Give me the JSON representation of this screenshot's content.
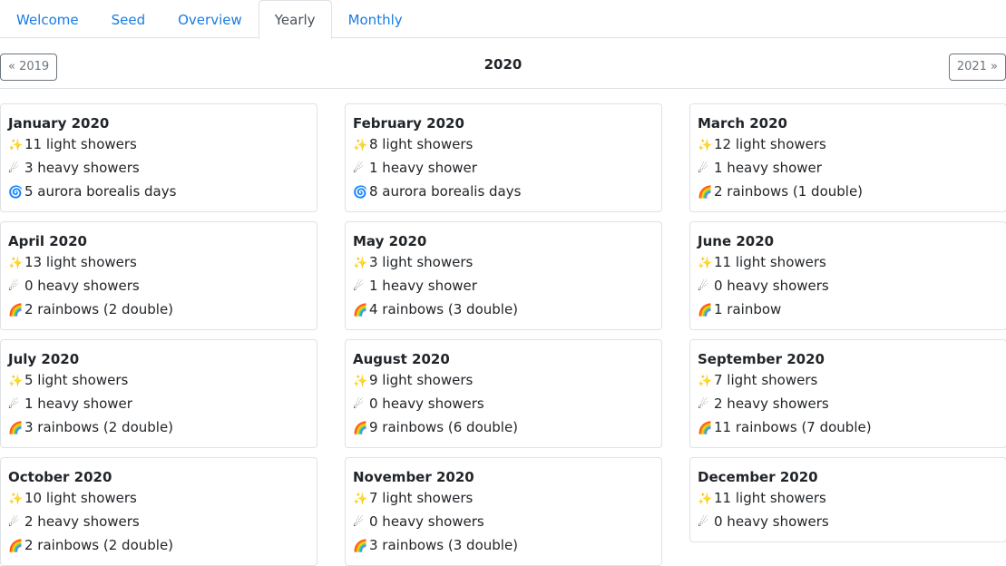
{
  "tabs": [
    {
      "label": "Welcome",
      "active": false
    },
    {
      "label": "Seed",
      "active": false
    },
    {
      "label": "Overview",
      "active": false
    },
    {
      "label": "Yearly",
      "active": true
    },
    {
      "label": "Monthly",
      "active": false
    }
  ],
  "year": {
    "title": "2020",
    "prev_label": "« 2019",
    "next_label": "2021 »"
  },
  "icons": {
    "light": "✨",
    "heavy": "☄",
    "aurora": "🌀",
    "rainbow": "🌈"
  },
  "months": [
    {
      "title": "January 2020",
      "lines": [
        {
          "icon": "light",
          "text": "11 light showers"
        },
        {
          "icon": "heavy",
          "text": "3 heavy showers"
        },
        {
          "icon": "aurora",
          "text": "5 aurora borealis days"
        }
      ]
    },
    {
      "title": "February 2020",
      "lines": [
        {
          "icon": "light",
          "text": "8 light showers"
        },
        {
          "icon": "heavy",
          "text": "1 heavy shower"
        },
        {
          "icon": "aurora",
          "text": "8 aurora borealis days"
        }
      ]
    },
    {
      "title": "March 2020",
      "lines": [
        {
          "icon": "light",
          "text": "12 light showers"
        },
        {
          "icon": "heavy",
          "text": "1 heavy shower"
        },
        {
          "icon": "rainbow",
          "text": "2 rainbows (1 double)"
        }
      ]
    },
    {
      "title": "April 2020",
      "lines": [
        {
          "icon": "light",
          "text": "13 light showers"
        },
        {
          "icon": "heavy",
          "text": "0 heavy showers"
        },
        {
          "icon": "rainbow",
          "text": "2 rainbows (2 double)"
        }
      ]
    },
    {
      "title": "May 2020",
      "lines": [
        {
          "icon": "light",
          "text": "3 light showers"
        },
        {
          "icon": "heavy",
          "text": "1 heavy shower"
        },
        {
          "icon": "rainbow",
          "text": "4 rainbows (3 double)"
        }
      ]
    },
    {
      "title": "June 2020",
      "lines": [
        {
          "icon": "light",
          "text": "11 light showers"
        },
        {
          "icon": "heavy",
          "text": "0 heavy showers"
        },
        {
          "icon": "rainbow",
          "text": "1 rainbow"
        }
      ]
    },
    {
      "title": "July 2020",
      "lines": [
        {
          "icon": "light",
          "text": "5 light showers"
        },
        {
          "icon": "heavy",
          "text": "1 heavy shower"
        },
        {
          "icon": "rainbow",
          "text": "3 rainbows (2 double)"
        }
      ]
    },
    {
      "title": "August 2020",
      "lines": [
        {
          "icon": "light",
          "text": "9 light showers"
        },
        {
          "icon": "heavy",
          "text": "0 heavy showers"
        },
        {
          "icon": "rainbow",
          "text": "9 rainbows (6 double)"
        }
      ]
    },
    {
      "title": "September 2020",
      "lines": [
        {
          "icon": "light",
          "text": "7 light showers"
        },
        {
          "icon": "heavy",
          "text": "2 heavy showers"
        },
        {
          "icon": "rainbow",
          "text": "11 rainbows (7 double)"
        }
      ]
    },
    {
      "title": "October 2020",
      "lines": [
        {
          "icon": "light",
          "text": "10 light showers"
        },
        {
          "icon": "heavy",
          "text": "2 heavy showers"
        },
        {
          "icon": "rainbow",
          "text": "2 rainbows (2 double)"
        }
      ]
    },
    {
      "title": "November 2020",
      "lines": [
        {
          "icon": "light",
          "text": "7 light showers"
        },
        {
          "icon": "heavy",
          "text": "0 heavy showers"
        },
        {
          "icon": "rainbow",
          "text": "3 rainbows (3 double)"
        }
      ]
    },
    {
      "title": "December 2020",
      "lines": [
        {
          "icon": "light",
          "text": "11 light showers"
        },
        {
          "icon": "heavy",
          "text": "0 heavy showers"
        }
      ]
    }
  ]
}
